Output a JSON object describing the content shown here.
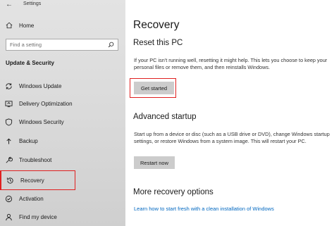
{
  "window": {
    "title": "Settings"
  },
  "sidebar": {
    "home_label": "Home",
    "search_placeholder": "Find a setting",
    "section_heading": "Update & Security",
    "items": [
      {
        "label": "Windows Update",
        "icon": "sync-icon"
      },
      {
        "label": "Delivery Optimization",
        "icon": "delivery-optimization-icon"
      },
      {
        "label": "Windows Security",
        "icon": "shield-icon"
      },
      {
        "label": "Backup",
        "icon": "backup-icon"
      },
      {
        "label": "Troubleshoot",
        "icon": "wrench-icon"
      },
      {
        "label": "Recovery",
        "icon": "recovery-icon",
        "selected": true
      },
      {
        "label": "Activation",
        "icon": "activation-icon"
      },
      {
        "label": "Find my device",
        "icon": "person-icon"
      }
    ]
  },
  "main": {
    "title": "Recovery",
    "reset": {
      "heading": "Reset this PC",
      "description": "If your PC isn't running well, resetting it might help. This lets you choose to keep your personal files or remove them, and then reinstalls Windows.",
      "button_label": "Get started"
    },
    "advanced": {
      "heading": "Advanced startup",
      "description": "Start up from a device or disc (such as a USB drive or DVD), change Windows startup settings, or restore Windows from a system image. This will restart your PC.",
      "button_label": "Restart now"
    },
    "more": {
      "heading": "More recovery options",
      "link_label": "Learn how to start fresh with a clean installation of Windows"
    }
  },
  "colors": {
    "accent": "#0078d7",
    "highlight": "#e02020",
    "link": "#0067c0"
  }
}
